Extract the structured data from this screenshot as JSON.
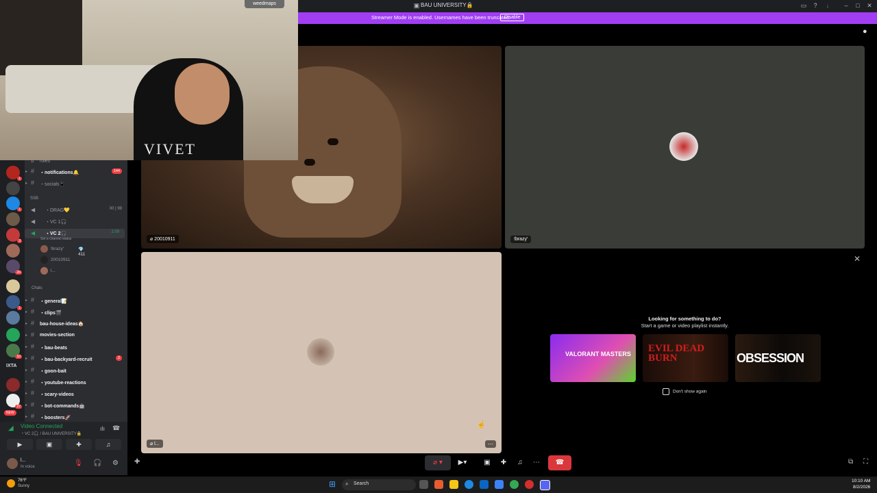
{
  "title_bar": {
    "title": "BAU UNIVERSITY🔒"
  },
  "streamer_banner": {
    "message": "Streamer Mode is enabled. Usernames have been truncated.",
    "disable_label": "Disable"
  },
  "webcam": {
    "badge": "weedmaps",
    "shirt_text": "VIVET"
  },
  "servers": {
    "labels": [
      "IXTA"
    ],
    "new_badge": "NEW",
    "badges": [
      "1",
      "1",
      "3",
      "26",
      "1",
      "10",
      "27"
    ]
  },
  "channels": {
    "partial_top": "roles",
    "items_top": [
      {
        "name": "・notifications🔔",
        "count": "144"
      },
      {
        "name": "・socials📱",
        "count": ""
      }
    ],
    "category_ssb": "SSB",
    "voice": [
      {
        "name": "・DRAG💛",
        "stat": "00 | 99"
      },
      {
        "name": "・VC 1🎧",
        "stat": ""
      },
      {
        "name": "・VC 2🎧",
        "stat": "1:09",
        "status": "Set a channel status"
      }
    ],
    "voice_users": [
      {
        "name": "!brazy'",
        "extra": "💎 411"
      },
      {
        "name": "20010911",
        "extra": ""
      },
      {
        "name": "l...",
        "extra": ""
      }
    ],
    "category_chats": "Chats",
    "items": [
      {
        "name": "・general📝",
        "count": ""
      },
      {
        "name": "・clips🎬",
        "count": ""
      },
      {
        "name": "bau-house-ideas🏠",
        "count": ""
      },
      {
        "name": "movies-section",
        "count": ""
      },
      {
        "name": "・bau-beats",
        "count": ""
      },
      {
        "name": "・bau-backyard-recruit",
        "count": "2"
      },
      {
        "name": "・goon-bait",
        "count": ""
      },
      {
        "name": "・youtube-reactions",
        "count": ""
      },
      {
        "name": "・scary-videos",
        "count": ""
      },
      {
        "name": "・bot-commands🤖",
        "count": ""
      },
      {
        "name": "・boosters🚀",
        "count": ""
      }
    ]
  },
  "voice_panel": {
    "status": "Video Connected",
    "sub": "・VC 2🎧 / BAU UNIVERSITY🔒"
  },
  "user_panel": {
    "name": "l...",
    "status": "In voice"
  },
  "tiles": {
    "tile1_label": "20010911",
    "tile2_label": "!brazy'",
    "tile3_label": "l..."
  },
  "activity": {
    "title": "Looking for something to do?",
    "subtitle": "Start a game or video playlist instantly.",
    "games": [
      "VALORANT MASTERS",
      "EVIL DEAD BURN",
      "OBSESSION"
    ],
    "dont_show": "Don't show again"
  },
  "taskbar": {
    "temp": "76°F",
    "weather": "Sunny",
    "search": "Search",
    "time": "10:10 AM",
    "date": "8/2/2026"
  },
  "colors": {
    "accent_purple": "#a13ef4",
    "connected_green": "#23a55a",
    "hangup_red": "#da373c"
  }
}
